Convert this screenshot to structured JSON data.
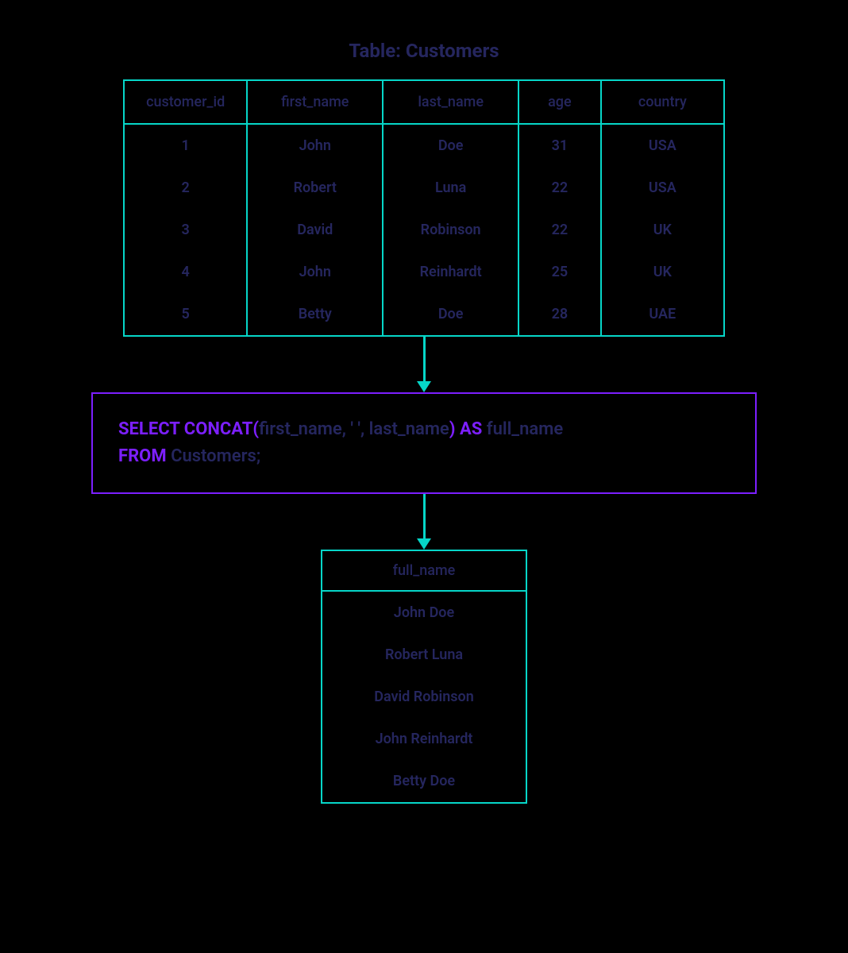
{
  "title": "Table: Customers",
  "customers": {
    "columns": [
      "customer_id",
      "first_name",
      "last_name",
      "age",
      "country"
    ],
    "rows": [
      {
        "customer_id": "1",
        "first_name": "John",
        "last_name": "Doe",
        "age": "31",
        "country": "USA"
      },
      {
        "customer_id": "2",
        "first_name": "Robert",
        "last_name": "Luna",
        "age": "22",
        "country": "USA"
      },
      {
        "customer_id": "3",
        "first_name": "David",
        "last_name": "Robinson",
        "age": "22",
        "country": "UK"
      },
      {
        "customer_id": "4",
        "first_name": "John",
        "last_name": "Reinhardt",
        "age": "25",
        "country": "UK"
      },
      {
        "customer_id": "5",
        "first_name": "Betty",
        "last_name": "Doe",
        "age": "28",
        "country": "UAE"
      }
    ]
  },
  "sql": {
    "select_kw": "SELECT CONCAT(",
    "select_args": "first_name, ' ', last_name",
    "close_as": ") AS",
    "alias": " full_name",
    "from_kw": "FROM",
    "from_table": " Customers;"
  },
  "result": {
    "column": "full_name",
    "rows": [
      "John Doe",
      "Robert Luna",
      "David Robinson",
      "John Reinhardt",
      "Betty Doe"
    ]
  },
  "colors": {
    "teal": "#06d6c8",
    "purple": "#7c1fff",
    "navy": "#25265e"
  }
}
